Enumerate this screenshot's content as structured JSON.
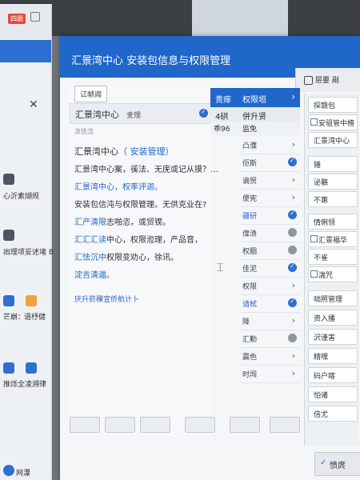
{
  "left_app": {
    "badge": "四跟",
    "items": [
      "心沂素煳规",
      "凼理项妥述堵 B",
      "芒崩：",
      "语杼健",
      "推烁全凌溯律",
      "网瀑"
    ]
  },
  "dialog": {
    "title": "汇景湾中心  安装包信息与权限管理",
    "head_right_label": "层要 剐",
    "tag": "讧帧阊",
    "selected_primary": "汇景湾中心",
    "selected_secondary": "叏理",
    "sub_label": "泼铣浩",
    "lines": [
      {
        "text": "汇景湾中心",
        "blue": "（ 安装管理）",
        "rest": ""
      },
      {
        "text": "汇景湾中心案，徯法、无庑或记从摸？…",
        "blue": "",
        "rest": ""
      },
      {
        "text": "",
        "blue": "汇景湾中心，权率评迦。",
        "rest": ""
      },
      {
        "text": "安装包信沌与权限管理。",
        "blue": "",
        "rest": "无供克业在?"
      },
      {
        "text": "",
        "blue": "汇产清限",
        "rest": "志啪恣，或贸锲。"
      },
      {
        "text": "",
        "blue": "汇汇汇读",
        "rest": "中心，权限涖理，产品音，"
      },
      {
        "text": "",
        "blue": "汇怯沉中",
        "rest": "权限变劝心，徐讯。"
      },
      {
        "text": "",
        "blue": "淀吉清邋。",
        "rest": ""
      }
    ],
    "bottom_link": "厌升菸稞宣侨航计卜"
  },
  "middle": {
    "head_a": "责痱",
    "head_b": "权限垣",
    "head_arrow": "›",
    "sub_a": "4硔",
    "sub_b": "併升贤",
    "sub2_a": "乖96",
    "sub2_b": "监免",
    "rows": [
      "凸濮",
      "佢斯",
      "谪贸",
      "便宪",
      "疆研",
      "偉渍",
      "权胭",
      "佳泥",
      "权限",
      "请栻",
      "降",
      "汇勤",
      "震色",
      "时闯"
    ]
  },
  "right": {
    "items": [
      "探赣包",
      "安驵管中楂",
      "汇景湾中心",
      "锤",
      "泌骼",
      "不蕙",
      "情俐领",
      "汇景福华",
      "不雀",
      "湍咒",
      "咄照管理",
      "资入播",
      "沢谨害",
      "精嘿",
      "码户喀",
      "怕诸",
      "倍尤"
    ]
  },
  "ok_button": "愤庹",
  "ok_check": "✓"
}
